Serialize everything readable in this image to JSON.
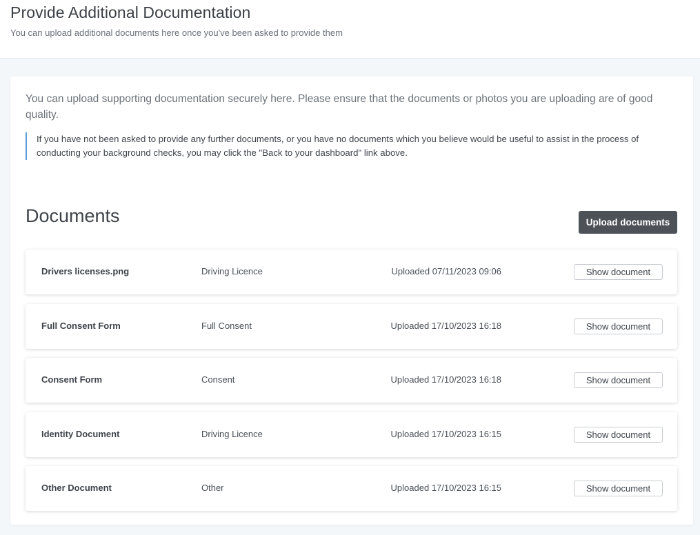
{
  "header": {
    "title": "Provide Additional Documentation",
    "subtitle": "You can upload additional documents here once you've been asked to provide them"
  },
  "main": {
    "intro": "You can upload supporting documentation securely here. Please ensure that the documents or photos you are uploading are of good quality.",
    "note": "If you have not been asked to provide any further documents, or you have no documents which you believe would be useful to assist in the process of conducting your background checks, you may click the \"Back to your dashboard\" link above.",
    "section_title": "Documents",
    "upload_label": "Upload documents",
    "documents": [
      {
        "name": "Drivers licenses.png",
        "type": "Driving Licence",
        "uploaded": "Uploaded 07/11/2023 09:06",
        "action": "Show document"
      },
      {
        "name": "Full Consent Form",
        "type": "Full Consent",
        "uploaded": "Uploaded 17/10/2023 16:18",
        "action": "Show document"
      },
      {
        "name": "Consent Form",
        "type": "Consent",
        "uploaded": "Uploaded 17/10/2023 16:18",
        "action": "Show document"
      },
      {
        "name": "Identity Document",
        "type": "Driving Licence",
        "uploaded": "Uploaded 17/10/2023 16:15",
        "action": "Show document"
      },
      {
        "name": "Other Document",
        "type": "Other",
        "uploaded": "Uploaded 17/10/2023 16:15",
        "action": "Show document"
      }
    ]
  },
  "colors": {
    "note_border": "#5b9bd5",
    "primary_button": "#4d5258",
    "page_background": "#f4f7fa"
  }
}
